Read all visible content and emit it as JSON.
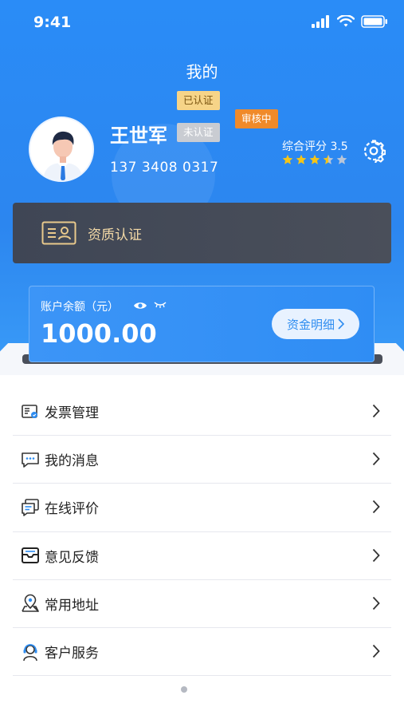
{
  "status_bar": {
    "time": "9:41"
  },
  "nav": {
    "title": "我的"
  },
  "user": {
    "name": "王世军",
    "phone": "137 3408 0317",
    "tags": {
      "verified": "已认证",
      "unverified": "未认证",
      "reviewing": "审核中"
    },
    "rating_label": "综合评分 3.5",
    "rating_value": 3.5,
    "rating_max": 5
  },
  "qualification": {
    "label": "资质认证"
  },
  "balance": {
    "label": "账户余额（元）",
    "amount": "1000.00",
    "detail_button": "资金明细"
  },
  "menu": [
    {
      "label": "发票管理",
      "icon": "invoice-icon"
    },
    {
      "label": "我的消息",
      "icon": "message-icon"
    },
    {
      "label": "在线评价",
      "icon": "review-icon"
    },
    {
      "label": "意见反馈",
      "icon": "feedback-icon"
    },
    {
      "label": "常用地址",
      "icon": "location-icon"
    },
    {
      "label": "客户服务",
      "icon": "customer-service-icon"
    }
  ],
  "colors": {
    "primary": "#2c86ef",
    "tag_verified": "#f6d488",
    "tag_review": "#f08a2a",
    "qual_card": "#454b58",
    "qual_text": "#f3d9a6",
    "star_filled": "#f5c518",
    "star_empty": "#b9c6d8"
  }
}
